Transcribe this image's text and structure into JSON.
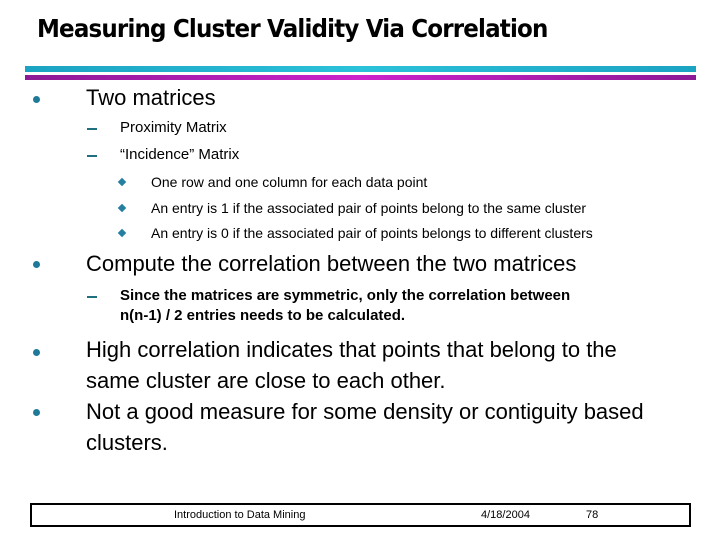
{
  "slide": {
    "title": "Measuring Cluster Validity Via Correlation",
    "colors": {
      "rule_top": "#1ba3c2",
      "rule_bottom": "#8c1a96",
      "bullet": "#1f7a99"
    },
    "bullets": [
      {
        "text": "Two matrices",
        "icon": "round-bullet",
        "children": [
          {
            "text": "Proximity Matrix",
            "icon": "dash"
          },
          {
            "text": "“Incidence” Matrix",
            "icon": "dash",
            "children": [
              {
                "text": "One row and one column for each data point",
                "icon": "diamond-bullet"
              },
              {
                "text": "An entry is 1 if the associated pair of points belong to the same cluster",
                "icon": "diamond-bullet"
              },
              {
                "text": "An entry is 0 if the associated pair of points belongs to different clusters",
                "icon": "diamond-bullet"
              }
            ]
          }
        ]
      },
      {
        "text": "Compute the correlation between the two matrices",
        "icon": "round-bullet",
        "children": [
          {
            "text_line1": "Since the matrices are symmetric, only the correlation between",
            "text_line2": "n(n-1) / 2 entries needs to be calculated.",
            "icon": "dash"
          }
        ]
      },
      {
        "text_line1": "High correlation indicates that points that belong to the",
        "text_line2": "same cluster are close to each other.",
        "icon": "round-bullet"
      },
      {
        "text_line1": "Not a good measure for some density or contiguity based",
        "text_line2": "clusters.",
        "icon": "round-bullet"
      }
    ]
  },
  "footer": {
    "course": "Introduction to Data Mining",
    "date": "4/18/2004",
    "page_number": "78"
  }
}
